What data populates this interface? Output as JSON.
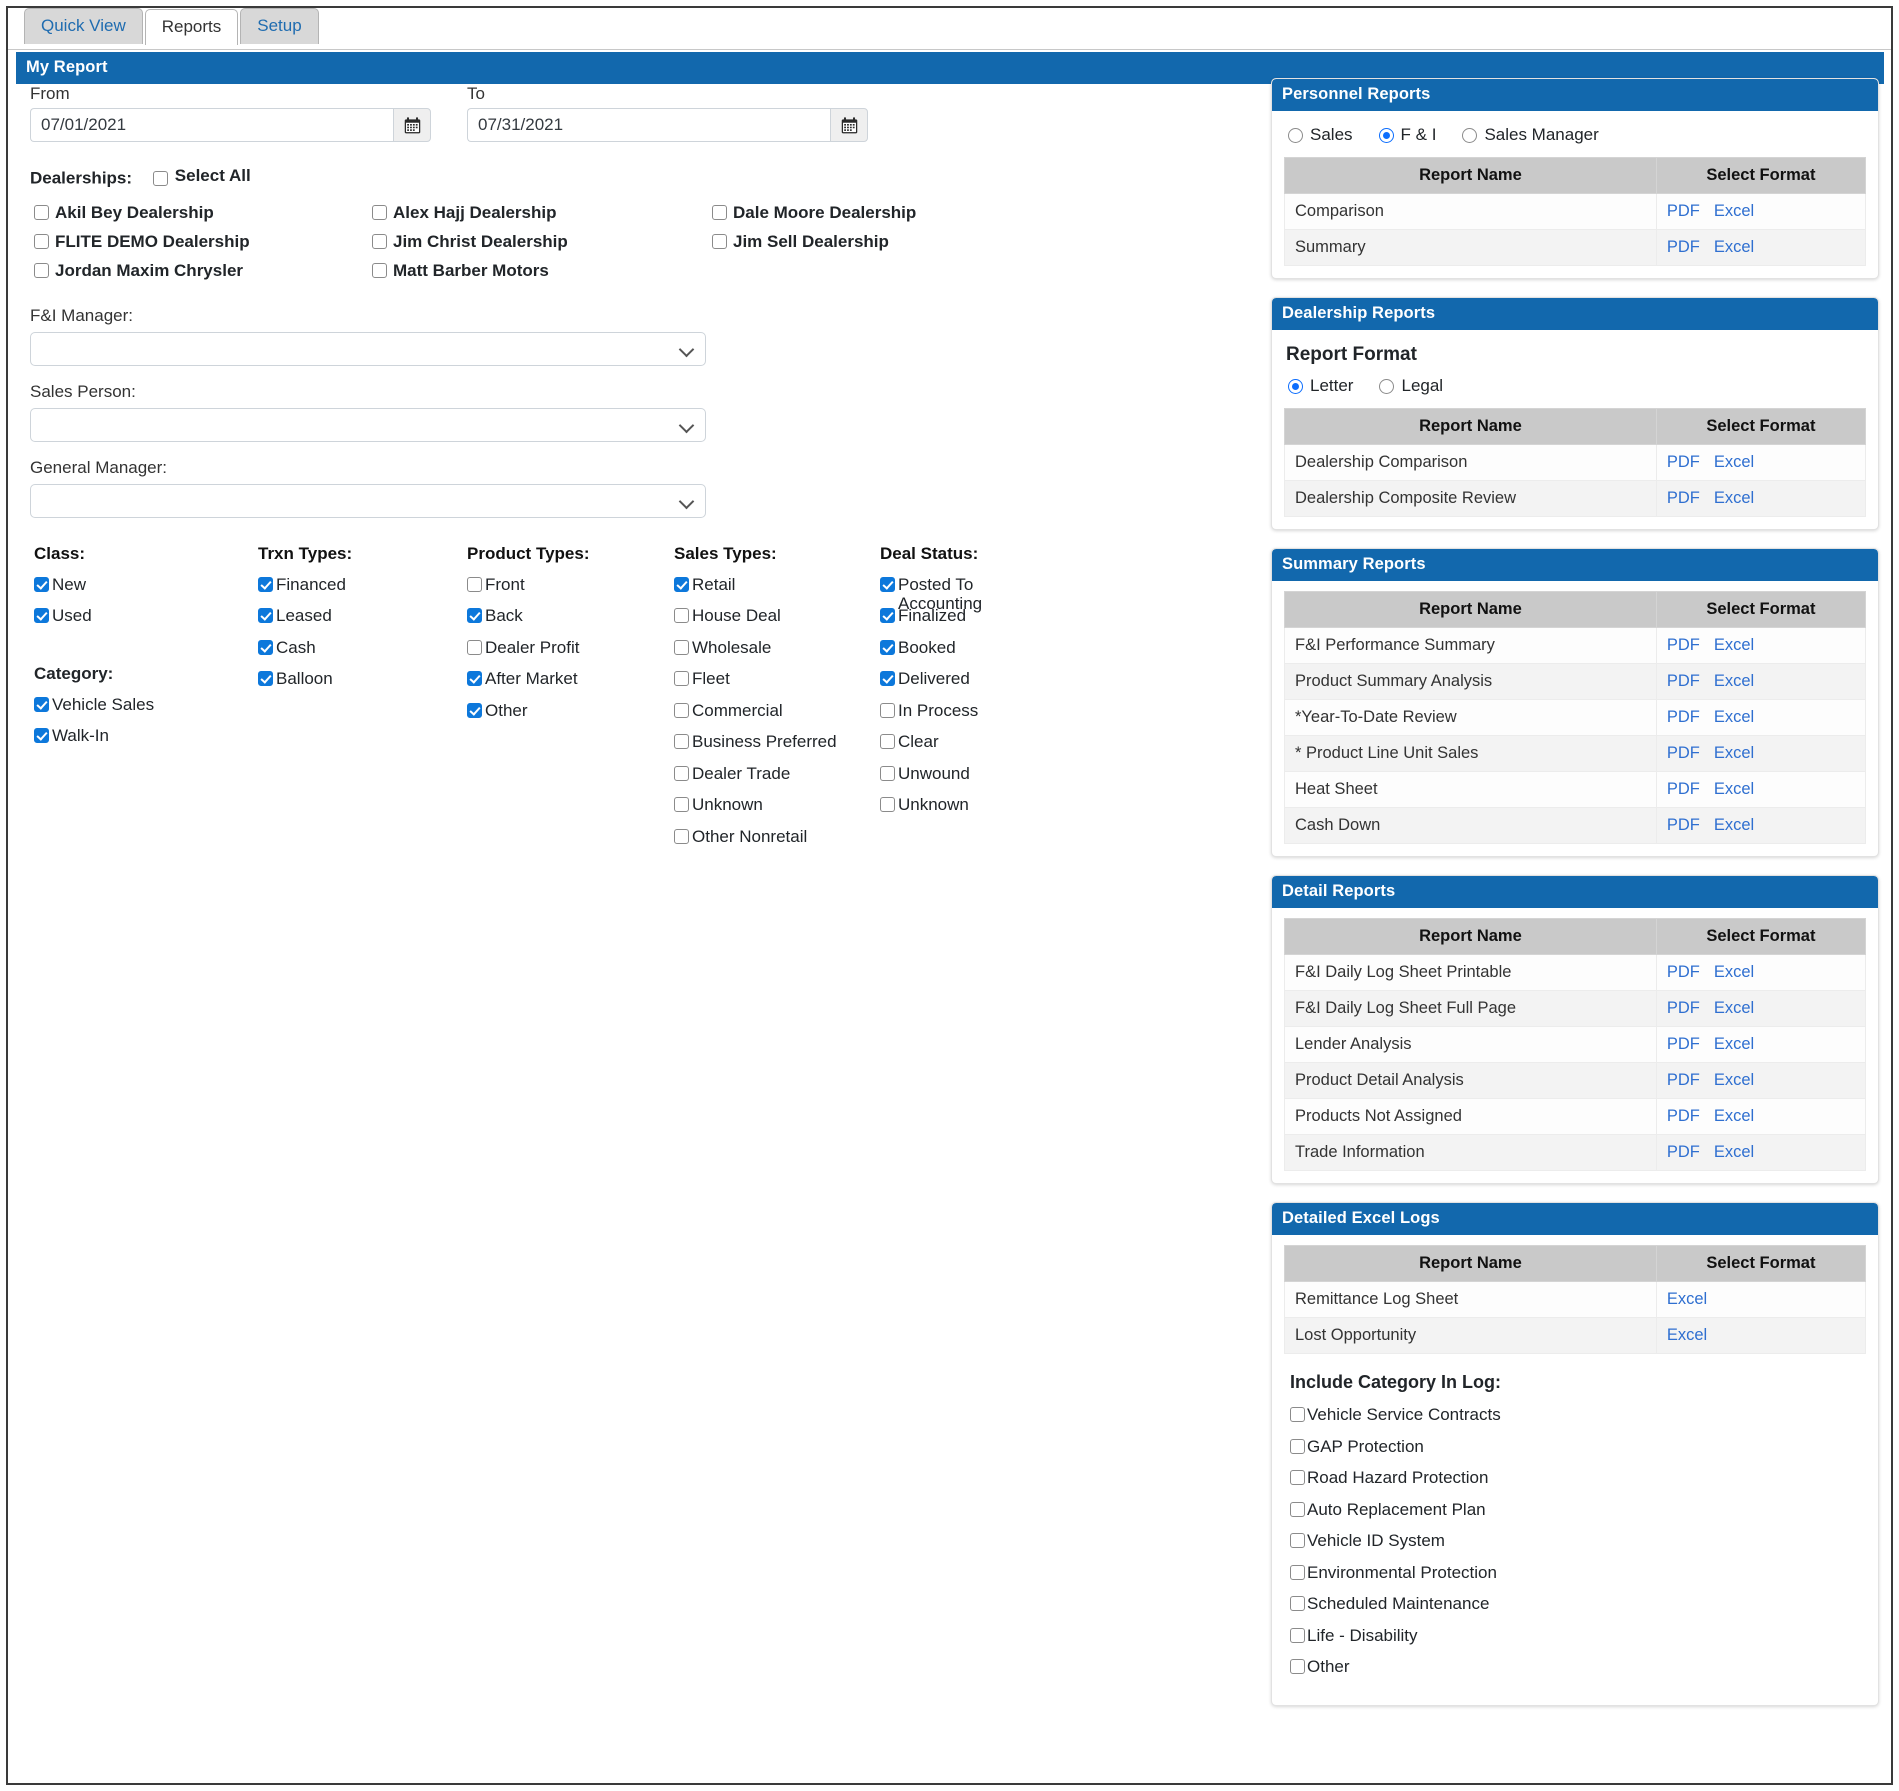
{
  "tabs": [
    {
      "label": "Quick View",
      "active": false
    },
    {
      "label": "Reports",
      "active": true
    },
    {
      "label": "Setup",
      "active": false
    }
  ],
  "page": {
    "title": "My Report"
  },
  "colors": {
    "accent": "#1268ad",
    "link": "#2f6fd0",
    "checkbox": "#0d78db"
  },
  "dates": {
    "from_label": "From",
    "to_label": "To",
    "from_value": "07/01/2021",
    "to_value": "07/31/2021",
    "calendar_icon": "calendar-icon"
  },
  "dealerships": {
    "label": "Dealerships:",
    "select_all_label": "Select All",
    "select_all_checked": false,
    "items": [
      {
        "label": "Akil Bey Dealership",
        "checked": false
      },
      {
        "label": "Alex Hajj Dealership",
        "checked": false
      },
      {
        "label": "Dale Moore Dealership",
        "checked": false
      },
      {
        "label": "FLITE DEMO Dealership",
        "checked": false
      },
      {
        "label": "Jim Christ Dealership",
        "checked": false
      },
      {
        "label": "Jim Sell Dealership",
        "checked": false
      },
      {
        "label": "Jordan Maxim Chrysler",
        "checked": false
      },
      {
        "label": "Matt Barber Motors",
        "checked": false
      }
    ]
  },
  "selects": [
    {
      "label": "F&I Manager:",
      "value": ""
    },
    {
      "label": "Sales Person:",
      "value": ""
    },
    {
      "label": "General Manager:",
      "value": ""
    }
  ],
  "filters": {
    "class": {
      "title": "Class:",
      "items": [
        {
          "label": "New",
          "checked": true
        },
        {
          "label": "Used",
          "checked": true
        }
      ]
    },
    "category": {
      "title": "Category:",
      "items": [
        {
          "label": "Vehicle Sales",
          "checked": true
        },
        {
          "label": "Walk-In",
          "checked": true
        }
      ]
    },
    "trxn_types": {
      "title": "Trxn Types:",
      "items": [
        {
          "label": "Financed",
          "checked": true
        },
        {
          "label": "Leased",
          "checked": true
        },
        {
          "label": "Cash",
          "checked": true
        },
        {
          "label": "Balloon",
          "checked": true
        }
      ]
    },
    "product_types": {
      "title": "Product Types:",
      "items": [
        {
          "label": "Front",
          "checked": false
        },
        {
          "label": "Back",
          "checked": true
        },
        {
          "label": "Dealer Profit",
          "checked": false
        },
        {
          "label": "After Market",
          "checked": true
        },
        {
          "label": "Other",
          "checked": true
        }
      ]
    },
    "sales_types": {
      "title": "Sales Types:",
      "items": [
        {
          "label": "Retail",
          "checked": true
        },
        {
          "label": "House Deal",
          "checked": false
        },
        {
          "label": "Wholesale",
          "checked": false
        },
        {
          "label": "Fleet",
          "checked": false
        },
        {
          "label": "Commercial",
          "checked": false
        },
        {
          "label": "Business Preferred",
          "checked": false
        },
        {
          "label": "Dealer Trade",
          "checked": false
        },
        {
          "label": "Unknown",
          "checked": false
        },
        {
          "label": "Other Nonretail",
          "checked": false
        }
      ]
    },
    "deal_status": {
      "title": "Deal Status:",
      "items": [
        {
          "label": "Posted To Accounting",
          "checked": true
        },
        {
          "label": "Finalized",
          "checked": true
        },
        {
          "label": "Booked",
          "checked": true
        },
        {
          "label": "Delivered",
          "checked": true
        },
        {
          "label": "In Process",
          "checked": false
        },
        {
          "label": "Clear",
          "checked": false
        },
        {
          "label": "Unwound",
          "checked": false
        },
        {
          "label": "Unknown",
          "checked": false
        }
      ]
    }
  },
  "table_headers": {
    "report_name": "Report Name",
    "select_format": "Select Format"
  },
  "format_links": {
    "pdf": "PDF",
    "excel": "Excel"
  },
  "personnel_reports": {
    "title": "Personnel Reports",
    "radios": [
      {
        "label": "Sales",
        "checked": false
      },
      {
        "label": "F & I",
        "checked": true
      },
      {
        "label": "Sales Manager",
        "checked": false
      }
    ],
    "rows": [
      {
        "name": "Comparison",
        "formats": [
          "PDF",
          "Excel"
        ]
      },
      {
        "name": "Summary",
        "formats": [
          "PDF",
          "Excel"
        ]
      }
    ]
  },
  "dealership_reports": {
    "title": "Dealership Reports",
    "format_title": "Report Format",
    "radios": [
      {
        "label": "Letter",
        "checked": true
      },
      {
        "label": "Legal",
        "checked": false
      }
    ],
    "rows": [
      {
        "name": "Dealership Comparison",
        "formats": [
          "PDF",
          "Excel"
        ]
      },
      {
        "name": "Dealership Composite Review",
        "formats": [
          "PDF",
          "Excel"
        ]
      }
    ]
  },
  "summary_reports": {
    "title": "Summary Reports",
    "rows": [
      {
        "name": "F&I Performance Summary",
        "formats": [
          "PDF",
          "Excel"
        ]
      },
      {
        "name": "Product Summary Analysis",
        "formats": [
          "PDF",
          "Excel"
        ]
      },
      {
        "name": "*Year-To-Date Review",
        "formats": [
          "PDF",
          "Excel"
        ]
      },
      {
        "name": "* Product Line Unit Sales",
        "formats": [
          "PDF",
          "Excel"
        ]
      },
      {
        "name": "Heat Sheet",
        "formats": [
          "PDF",
          "Excel"
        ]
      },
      {
        "name": "Cash Down",
        "formats": [
          "PDF",
          "Excel"
        ]
      }
    ]
  },
  "detail_reports": {
    "title": "Detail Reports",
    "rows": [
      {
        "name": "F&I Daily Log Sheet Printable",
        "formats": [
          "PDF",
          "Excel"
        ]
      },
      {
        "name": "F&I Daily Log Sheet Full Page",
        "formats": [
          "PDF",
          "Excel"
        ]
      },
      {
        "name": "Lender Analysis",
        "formats": [
          "PDF",
          "Excel"
        ]
      },
      {
        "name": "Product Detail Analysis",
        "formats": [
          "PDF",
          "Excel"
        ]
      },
      {
        "name": "Products Not Assigned",
        "formats": [
          "PDF",
          "Excel"
        ]
      },
      {
        "name": "Trade Information",
        "formats": [
          "PDF",
          "Excel"
        ]
      }
    ]
  },
  "detailed_excel_logs": {
    "title": "Detailed Excel Logs",
    "rows": [
      {
        "name": "Remittance Log Sheet",
        "formats": [
          "Excel"
        ]
      },
      {
        "name": "Lost Opportunity",
        "formats": [
          "Excel"
        ]
      }
    ],
    "category_title": "Include Category In Log:",
    "categories": [
      {
        "label": "Vehicle Service Contracts",
        "checked": false
      },
      {
        "label": "GAP Protection",
        "checked": false
      },
      {
        "label": "Road Hazard Protection",
        "checked": false
      },
      {
        "label": "Auto Replacement Plan",
        "checked": false
      },
      {
        "label": "Vehicle ID System",
        "checked": false
      },
      {
        "label": "Environmental Protection",
        "checked": false
      },
      {
        "label": "Scheduled Maintenance",
        "checked": false
      },
      {
        "label": "Life - Disability",
        "checked": false
      },
      {
        "label": "Other",
        "checked": false
      }
    ]
  }
}
